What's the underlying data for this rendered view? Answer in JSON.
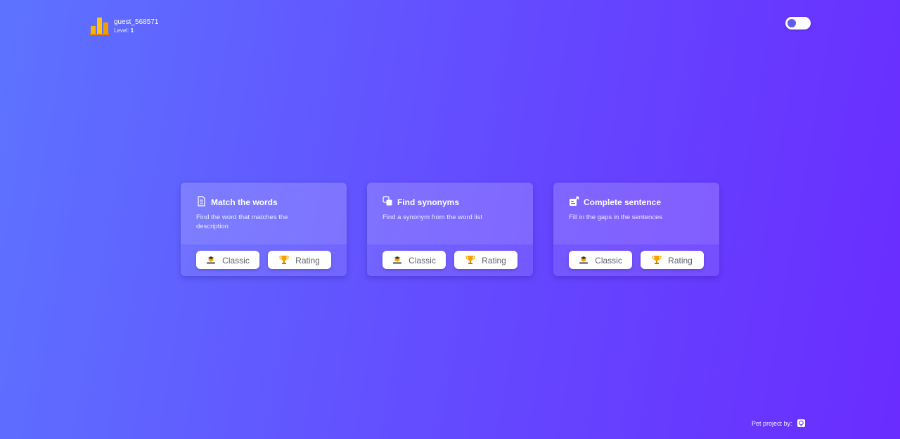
{
  "user": {
    "username": "guest_568571",
    "level_label": "Level:",
    "level_value": "1",
    "logo_icon": "bar-chart-logo-icon"
  },
  "theme_toggle": {
    "icon": "toggle-switch-icon"
  },
  "cards": [
    {
      "title": "Match the words",
      "description": "Find the word that matches the description",
      "icon": "document-icon",
      "buttons": [
        {
          "label": "Classic",
          "icon": "student-icon"
        },
        {
          "label": "Rating",
          "icon": "trophy-icon"
        }
      ]
    },
    {
      "title": "Find synonyms",
      "description": "Find a synonym from the word list",
      "icon": "copy-icon",
      "buttons": [
        {
          "label": "Classic",
          "icon": "student-icon"
        },
        {
          "label": "Rating",
          "icon": "trophy-icon"
        }
      ]
    },
    {
      "title": "Complete sentence",
      "description": "Fill in the gaps in the sentences",
      "icon": "edit-icon",
      "buttons": [
        {
          "label": "Classic",
          "icon": "student-icon"
        },
        {
          "label": "Rating",
          "icon": "trophy-icon"
        }
      ]
    }
  ],
  "footer": {
    "text": "Pet project by:",
    "icon": "github-icon"
  },
  "colors": {
    "background_start": "#5d73ff",
    "background_end": "#6a2cff",
    "toggle_knob": "#6358f0",
    "trophy": "#f5a300",
    "logo_bar": "#f7b500"
  }
}
